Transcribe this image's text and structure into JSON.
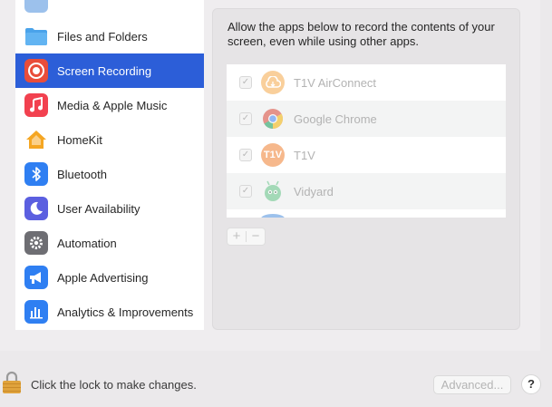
{
  "sidebar": {
    "items": [
      {
        "label": "Files and Folders",
        "icon": "folder-icon",
        "color": "#4aa0e8",
        "selected": false
      },
      {
        "label": "Screen Recording",
        "icon": "screen-recording-icon",
        "color": "#e94d3a",
        "selected": true
      },
      {
        "label": "Media & Apple Music",
        "icon": "music-icon",
        "color": "#f2414f",
        "selected": false
      },
      {
        "label": "HomeKit",
        "icon": "home-icon",
        "color": "#f5a623",
        "selected": false
      },
      {
        "label": "Bluetooth",
        "icon": "bluetooth-icon",
        "color": "#2f7ff2",
        "selected": false
      },
      {
        "label": "User Availability",
        "icon": "moon-icon",
        "color": "#5b5fe0",
        "selected": false
      },
      {
        "label": "Automation",
        "icon": "gear-icon",
        "color": "#6e6e73",
        "selected": false
      },
      {
        "label": "Apple Advertising",
        "icon": "megaphone-icon",
        "color": "#2f7ff2",
        "selected": false
      },
      {
        "label": "Analytics & Improvements",
        "icon": "chart-icon",
        "color": "#2f7ff2",
        "selected": false
      }
    ]
  },
  "main": {
    "description": "Allow the apps below to record the contents of your screen, even while using other apps.",
    "apps": [
      {
        "name": "T1V AirConnect",
        "checked": true,
        "icon": "t1v-airconnect-icon",
        "color": "#f5a94a"
      },
      {
        "name": "Google Chrome",
        "checked": true,
        "icon": "chrome-icon",
        "color": "#4285f4"
      },
      {
        "name": "T1V",
        "checked": true,
        "icon": "t1v-icon",
        "color": "#f07f2f",
        "icon_text": "T1V"
      },
      {
        "name": "Vidyard",
        "checked": true,
        "icon": "vidyard-icon",
        "color": "#63c387"
      }
    ],
    "add_label": "+",
    "remove_label": "−"
  },
  "footer": {
    "lock_text": "Click the lock to make changes.",
    "advanced_label": "Advanced...",
    "help_label": "?"
  }
}
